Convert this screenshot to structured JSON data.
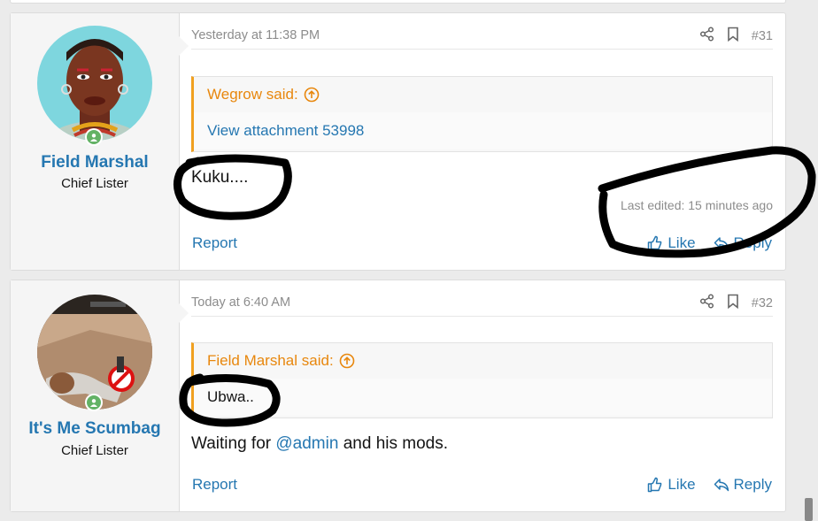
{
  "posts": [
    {
      "user": {
        "name": "Field Marshal",
        "title": "Chief Lister"
      },
      "date": "Yesterday at 11:38 PM",
      "number": "#31",
      "quote": {
        "author_line": "Wegrow said:",
        "body": "View attachment 53998"
      },
      "message": "Kuku....",
      "last_edited": "Last edited: 15 minutes ago",
      "actions": {
        "report": "Report",
        "like": "Like",
        "reply": "Reply"
      }
    },
    {
      "user": {
        "name": "It's Me Scumbag",
        "title": "Chief Lister"
      },
      "date": "Today at 6:40 AM",
      "number": "#32",
      "quote": {
        "author_line": "Field Marshal said:",
        "body": "Ubwa.."
      },
      "message_parts": {
        "before": "Waiting for ",
        "mention": "@admin",
        "after": " and his mods."
      },
      "actions": {
        "report": "Report",
        "like": "Like",
        "reply": "Reply"
      }
    }
  ],
  "icons": {
    "share": "share-icon",
    "bookmark": "bookmark-icon",
    "like": "thumbs-up-icon",
    "reply": "reply-icon",
    "quote_expand": "arrow-up-circle-icon",
    "online": "online-status-icon"
  },
  "colors": {
    "accent": "#2577b1",
    "quote_accent": "#f0a020",
    "online": "#63b265"
  }
}
